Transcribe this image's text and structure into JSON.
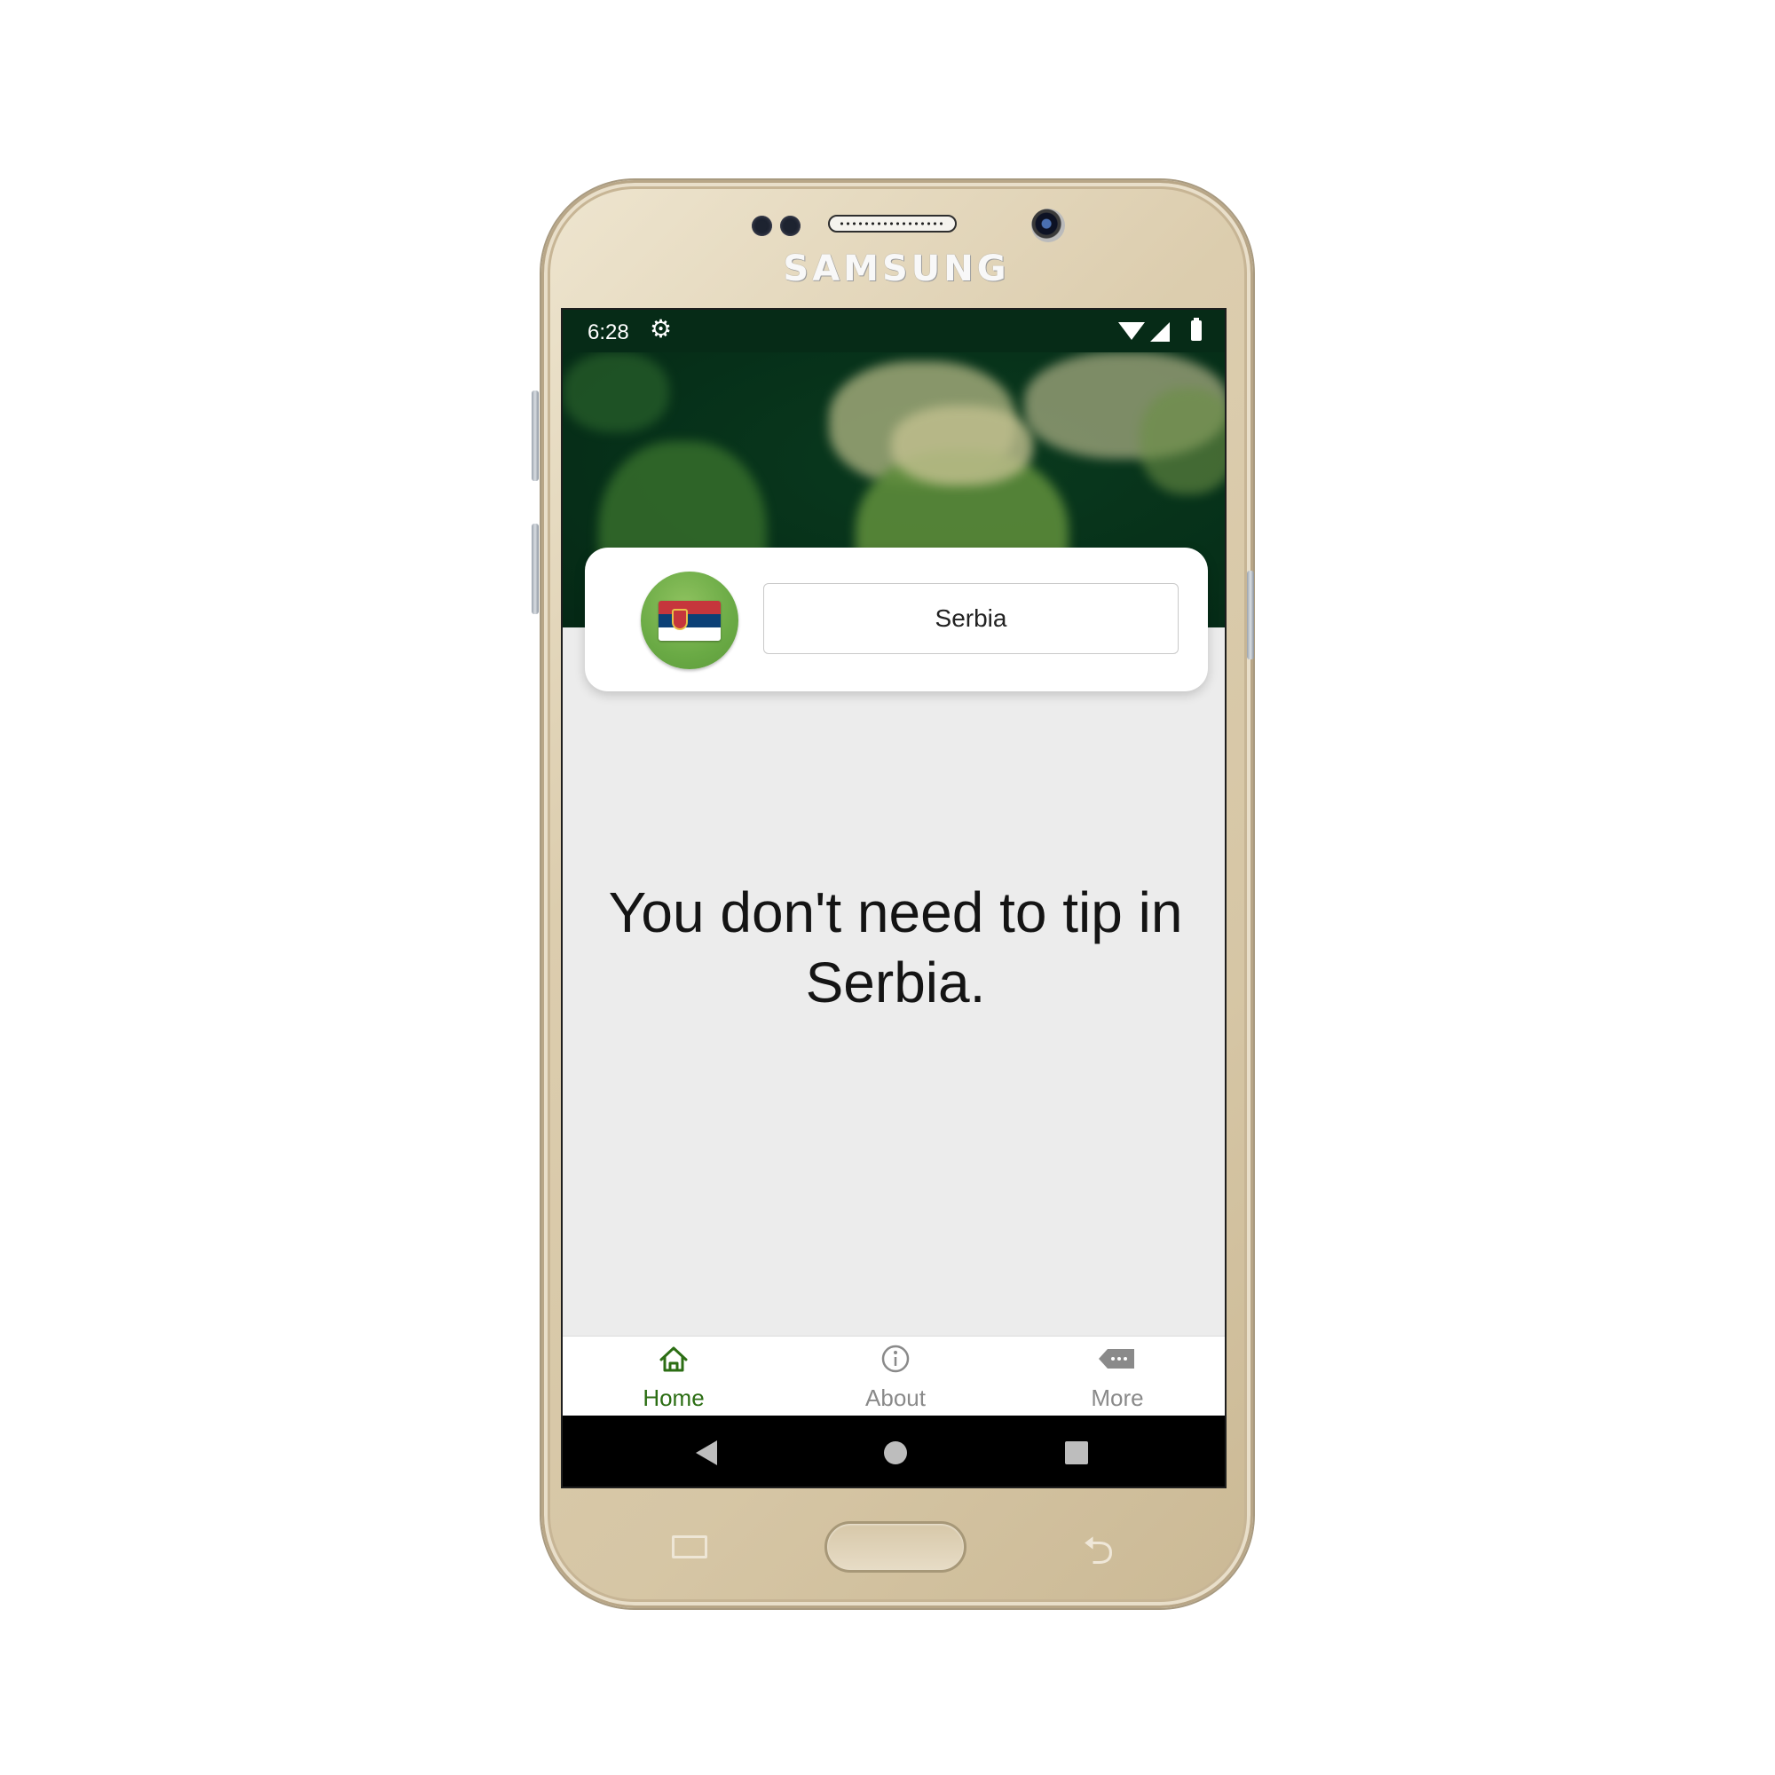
{
  "device": {
    "brand": "SAMSUNG"
  },
  "status_bar": {
    "time": "6:28",
    "settings_icon": "gear-icon",
    "wifi_icon": "wifi-icon",
    "signal_icon": "signal-icon",
    "battery_icon": "battery-icon"
  },
  "header": {
    "country_flag_icon": "serbia-flag-icon",
    "country_value": "Serbia"
  },
  "main": {
    "message": "You don't need to tip in Serbia."
  },
  "bottom_nav": {
    "items": [
      {
        "label": "Home",
        "icon": "home-icon",
        "active": true
      },
      {
        "label": "About",
        "icon": "info-icon",
        "active": false
      },
      {
        "label": "More",
        "icon": "more-tag-icon",
        "active": false
      }
    ]
  },
  "system_nav": {
    "back_icon": "back-triangle-icon",
    "home_icon": "home-circle-icon",
    "recents_icon": "recents-square-icon"
  },
  "colors": {
    "header_green": "#062b17",
    "accent_green": "#2c6e14",
    "flag_circle_green": "#6aaa45",
    "inactive_tab": "#8a8a8a",
    "phone_gold": "#d6c6a5"
  }
}
